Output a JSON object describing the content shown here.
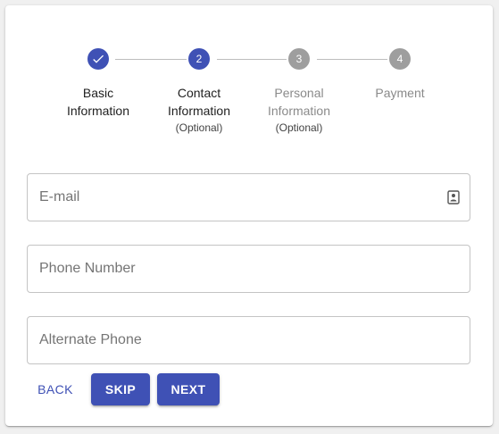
{
  "stepper": {
    "steps": [
      {
        "label_line1": "Basic",
        "label_line2": "Information",
        "optional": "",
        "number": "",
        "state": "completed",
        "icon": "check-icon"
      },
      {
        "label_line1": "Contact",
        "label_line2": "Information",
        "optional": "(Optional)",
        "number": "2",
        "state": "active"
      },
      {
        "label_line1": "Personal",
        "label_line2": "Information",
        "optional": "(Optional)",
        "number": "3",
        "state": "inactive"
      },
      {
        "label_line1": "Payment",
        "label_line2": "",
        "optional": "",
        "number": "4",
        "state": "inactive"
      }
    ]
  },
  "form": {
    "email": {
      "placeholder": "E-mail",
      "value": "",
      "icon": "contact-card-icon"
    },
    "phone": {
      "placeholder": "Phone Number",
      "value": ""
    },
    "alt_phone": {
      "placeholder": "Alternate Phone",
      "value": ""
    }
  },
  "actions": {
    "back_label": "Back",
    "skip_label": "Skip",
    "next_label": "Next"
  },
  "colors": {
    "primary": "#3f51b5",
    "inactive": "#9e9e9e",
    "border": "#c4c4c4"
  }
}
